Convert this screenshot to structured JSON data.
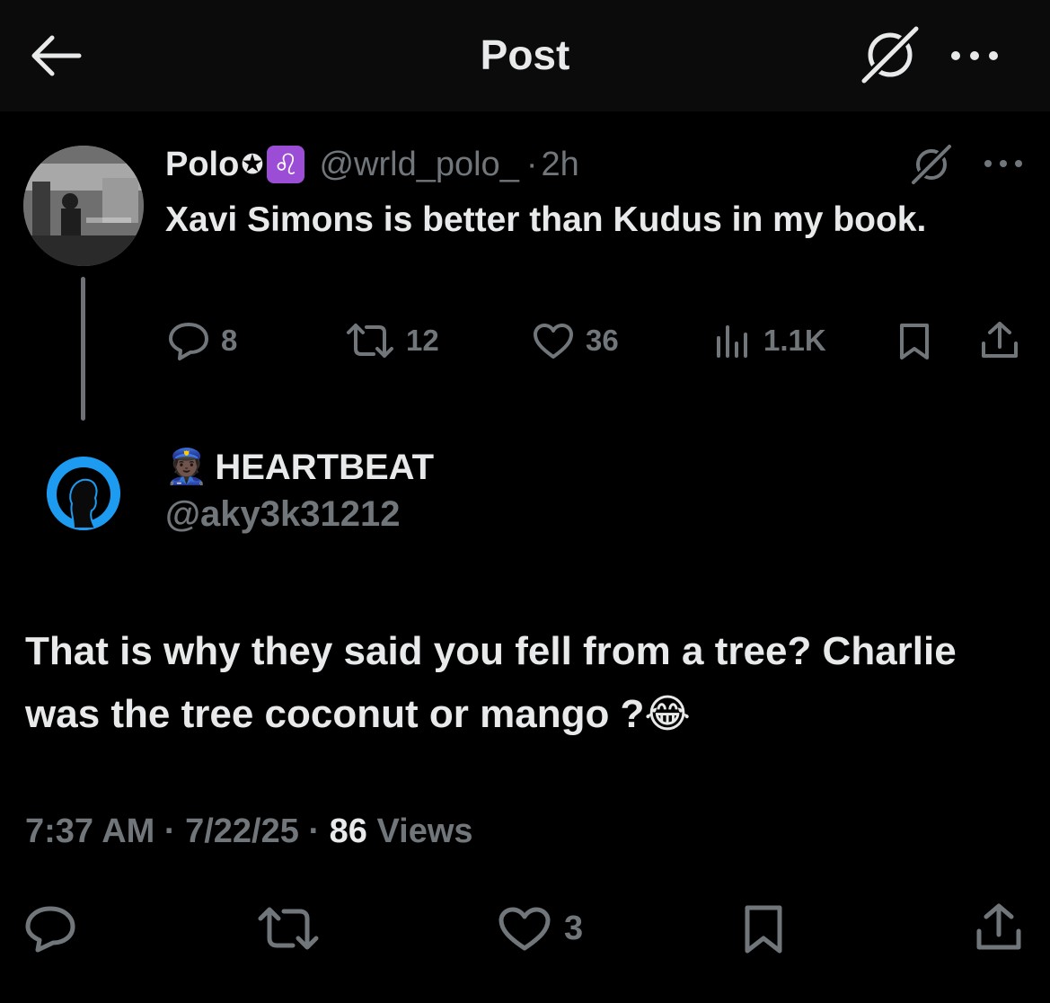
{
  "header": {
    "title": "Post",
    "back_icon": "arrow-left-icon",
    "grok_icon": "grok-icon",
    "more_icon": "more-dots-icon"
  },
  "parent_post": {
    "author_name": "Polo",
    "badge_star": "✪",
    "badge_leo": "♌",
    "handle": "@wrld_polo_",
    "separator": "·",
    "time": "2h",
    "text": "Xavi Simons is better than Kudus in my book.",
    "replies": "8",
    "reposts": "12",
    "likes": "36",
    "views": "1.1K"
  },
  "reply_post": {
    "badge_emoji": "👮🏿",
    "author_name": "HEARTBEAT",
    "handle": "@aky3k31212",
    "text": "That is why they said you fell from a tree? Charlie was the tree coconut or mango ?😂",
    "time": "7:37 AM",
    "separator1": " · ",
    "date": "7/22/25",
    "separator2": " · ",
    "views_count": "86",
    "views_label": " Views",
    "likes": "3"
  },
  "colors": {
    "background": "#000000",
    "text": "#e7e9ea",
    "muted": "#71767b",
    "accent": "#1d9bf0"
  }
}
